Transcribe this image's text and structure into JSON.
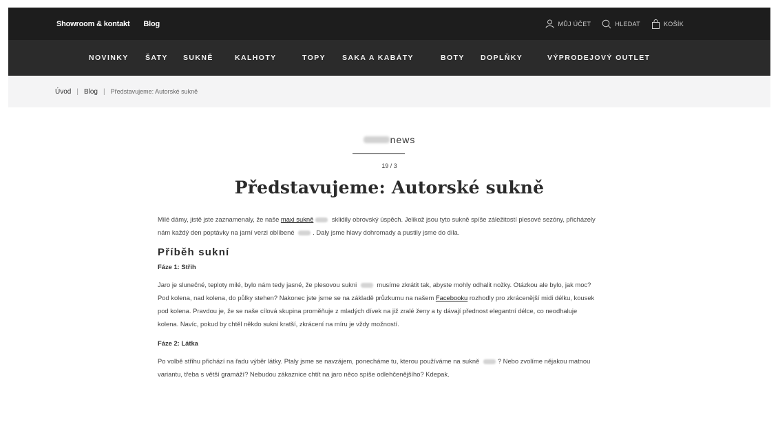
{
  "topbar": {
    "links": [
      "Showroom & kontakt",
      "Blog"
    ],
    "account_label": "MŮJ ÚČET",
    "search_label": "HLEDAT",
    "cart_label": "KOŠÍK"
  },
  "nav": [
    "NOVINKY",
    "ŠATY",
    "SUKNĚ",
    "KALHOTY",
    "TOPY",
    "SAKA A KABÁTY",
    "BOTY",
    "DOPLŇKY",
    "VÝPRODEJOVÝ OUTLET"
  ],
  "breadcrumb": {
    "home": "Úvod",
    "sep1": "|",
    "blog": "Blog",
    "sep2": "|",
    "current": "Představujeme: Autorské sukně"
  },
  "article": {
    "brand_suffix": "news",
    "date": "19 / 3",
    "title": "Představujeme: Autorské sukně",
    "p1_a": "Milé dámy, jistě jste zaznamenaly, že naše ",
    "p1_link": "maxi sukně",
    "p1_b": " sklidily obrovský úspěch. Jelikož jsou tyto sukně spíše záležitostí plesové sezóny, přicházely nám každý den poptávky na jarní verzi oblíbené ",
    "p1_c": ". Daly jsme hlavy dohromady a pustily jsme do díla.",
    "h2": "Příběh sukní",
    "phase1": "Fáze 1: Střih",
    "p2_a": "Jaro je slunečné, teploty milé, bylo nám tedy jasné, že plesovou sukni ",
    "p2_b": " musíme zkrátit tak, abyste mohly odhalit nožky. Otázkou ale bylo, jak moc? Pod kolena, nad kolena, do půlky stehen? Nakonec jste jsme se na základě průzkumu na našem ",
    "p2_link": "Facebooku",
    "p2_c": " rozhodly pro zkrácenější midi délku, kousek pod kolena. Pravdou je, že se naše cílová skupina proměňuje z mladých dívek na již zralé ženy a ty dávají přednost elegantní délce, co neodhaluje kolena. Navíc, pokud by chtěl někdo sukni kratší, zkrácení na míru je vždy možností.",
    "phase2": "Fáze 2: Látka",
    "p3_a": "Po volbě střihu přichází na řadu výběr látky. Ptaly jsme se navzájem, ponecháme tu, kterou používáme na sukně ",
    "p3_b": "? Nebo zvolíme nějakou matnou variantu, třeba s větší gramáží? Nebudou zákaznice chtít na jaro něco spíše odlehčenějšího? Kdepak."
  }
}
